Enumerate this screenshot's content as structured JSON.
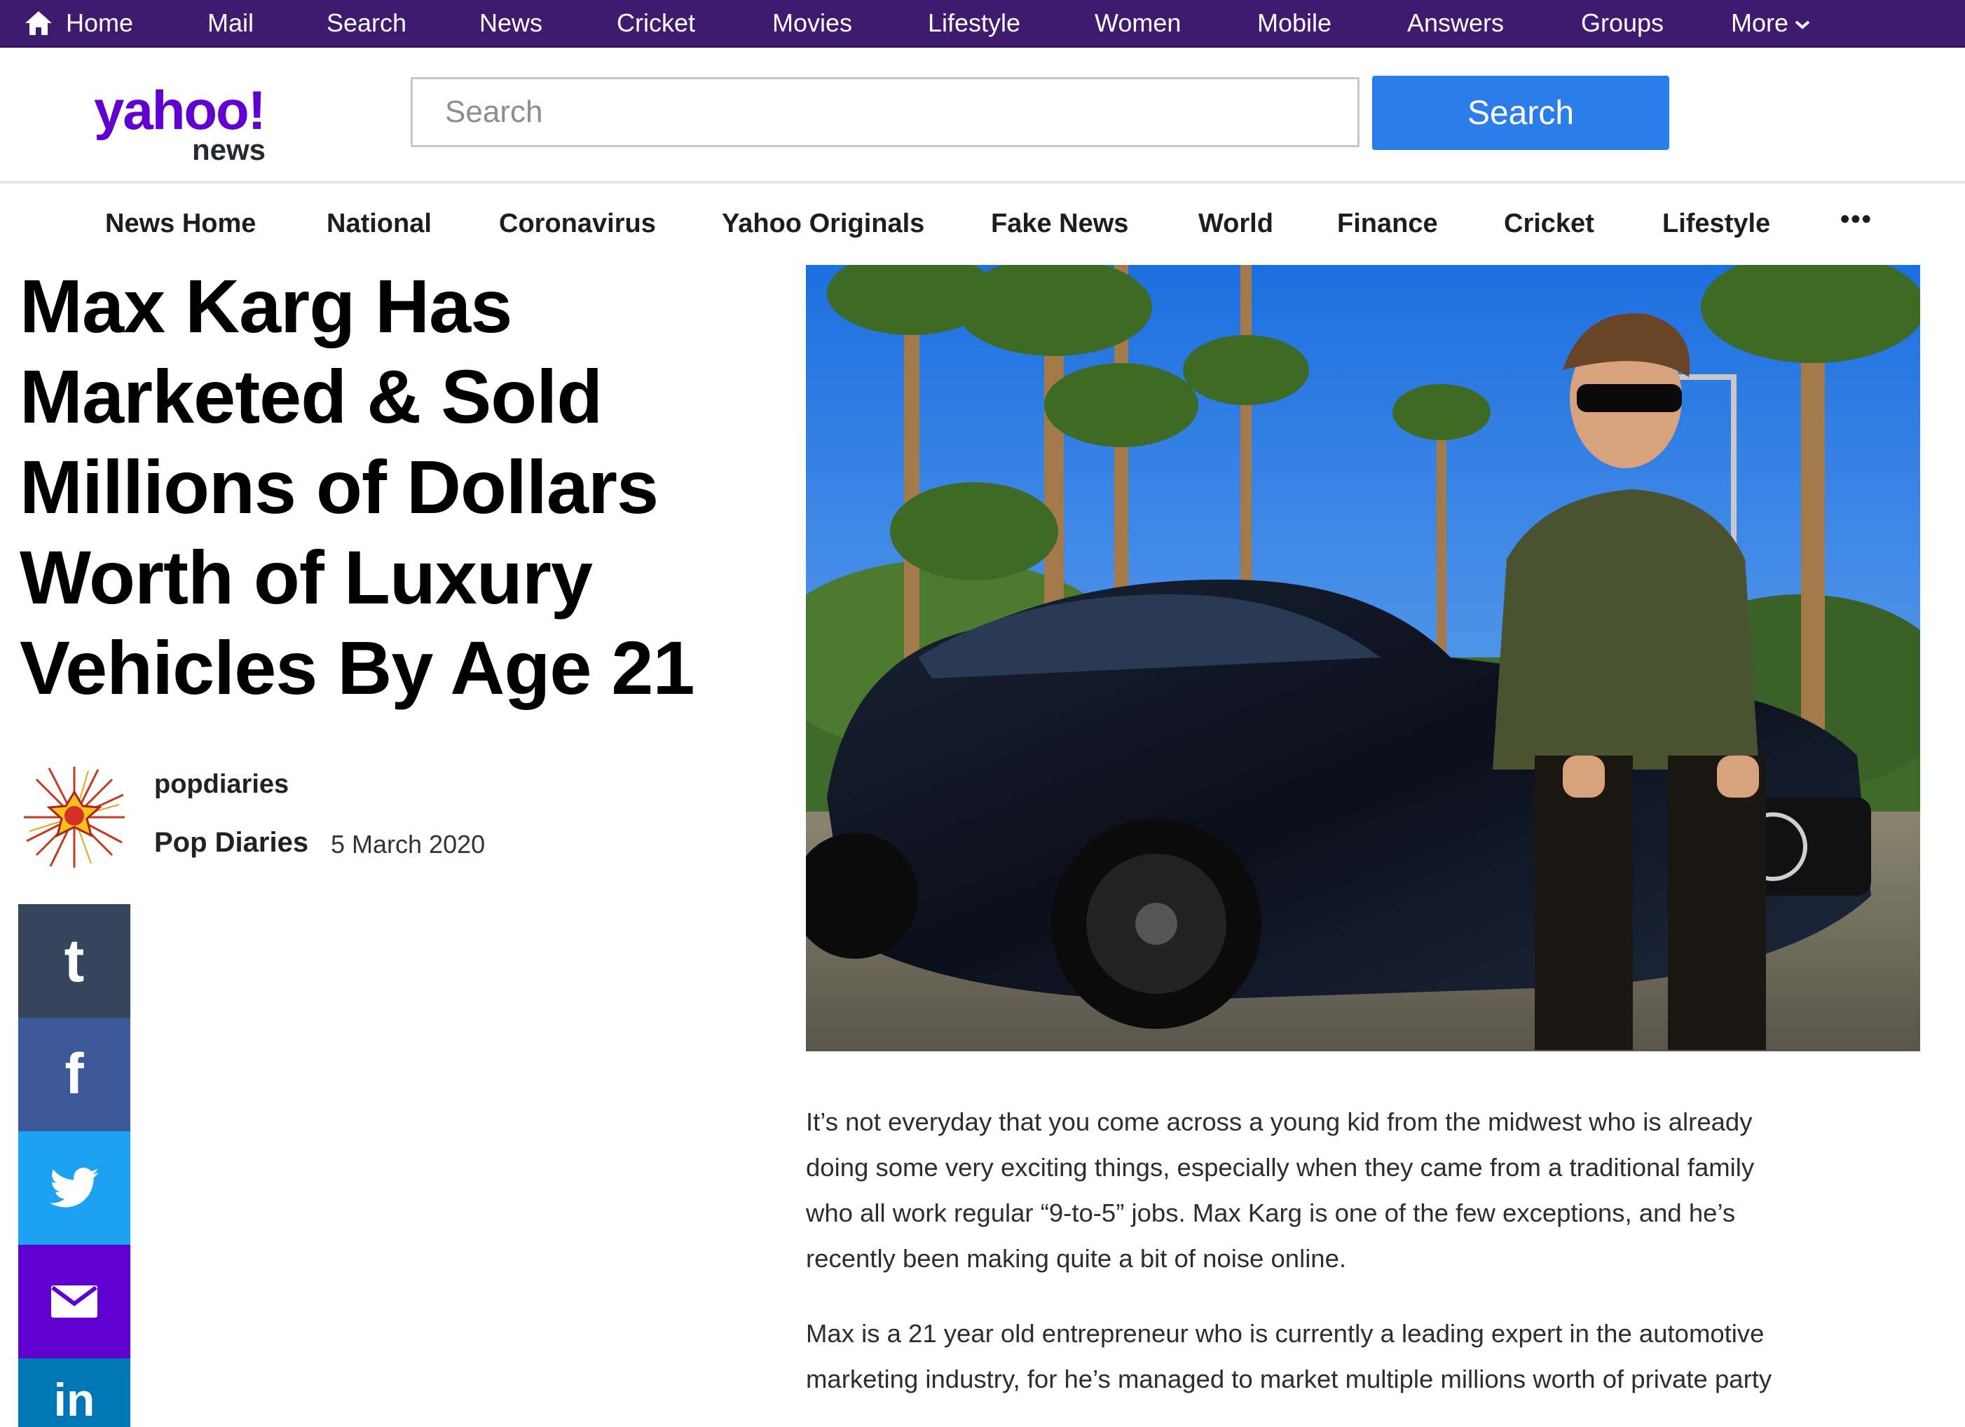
{
  "topnav": {
    "home": "Home",
    "items": [
      "Mail",
      "Search",
      "News",
      "Cricket",
      "Movies",
      "Lifestyle",
      "Women",
      "Mobile",
      "Answers",
      "Groups"
    ],
    "more": "More"
  },
  "header": {
    "logo_text": "yahoo!",
    "logo_sub": "news",
    "search_placeholder": "Search",
    "search_button": "Search"
  },
  "subnav": {
    "items": [
      "News Home",
      "National",
      "Coronavirus",
      "Yahoo Originals",
      "Fake News",
      "World",
      "Finance",
      "Cricket",
      "Lifestyle"
    ],
    "more": "•••"
  },
  "article": {
    "headline_lines": [
      "Max Karg Has",
      "Marketed & Sold",
      "Millions of Dollars",
      "Worth of Luxury",
      "Vehicles By Age 21"
    ],
    "author_handle": "popdiaries",
    "publisher": "Pop Diaries",
    "date": "5 March 2020",
    "paragraph1_lines": [
      "It’s not everyday that you come across a young kid from the midwest who is already",
      "doing some very exciting things, especially when they came from a traditional family",
      "who all work regular “9-to-5” jobs. Max Karg is one of the few exceptions, and he’s",
      "recently been making quite a bit of noise online."
    ],
    "paragraph2_lines": [
      "Max is a 21 year old entrepreneur who is currently a leading expert in the automotive",
      "marketing industry, for he’s managed to market multiple millions worth of private party"
    ]
  },
  "share": {
    "buttons": [
      {
        "name": "tumblr",
        "glyph": "t",
        "color": "#35465c"
      },
      {
        "name": "facebook",
        "glyph": "f",
        "color": "#3b5998"
      },
      {
        "name": "twitter",
        "glyph": "",
        "color": "#1da1f2"
      },
      {
        "name": "email",
        "glyph": "",
        "color": "#6001d2"
      },
      {
        "name": "linkedin",
        "glyph": "in",
        "color": "#0077b5"
      }
    ]
  },
  "colors": {
    "topbar": "#3f1a6e",
    "brand": "#6001d2",
    "search_button": "#2b7de9"
  }
}
